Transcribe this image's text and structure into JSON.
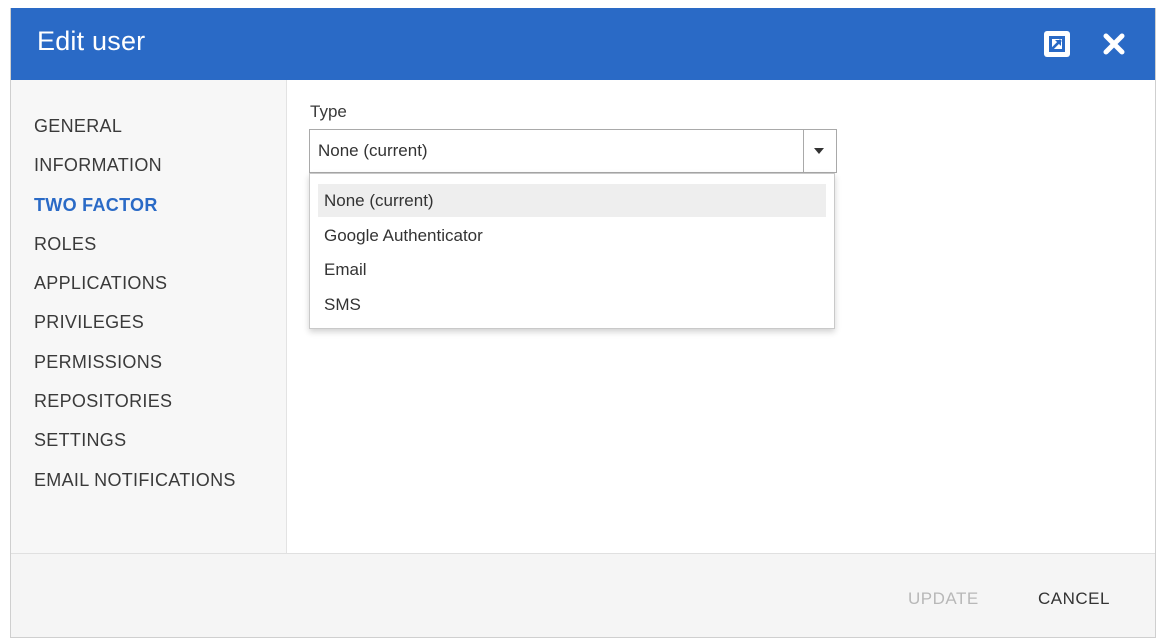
{
  "dialog": {
    "title": "Edit user"
  },
  "sidebar": {
    "items": [
      {
        "label": "GENERAL"
      },
      {
        "label": "INFORMATION"
      },
      {
        "label": "TWO FACTOR"
      },
      {
        "label": "ROLES"
      },
      {
        "label": "APPLICATIONS"
      },
      {
        "label": "PRIVILEGES"
      },
      {
        "label": "PERMISSIONS"
      },
      {
        "label": "REPOSITORIES"
      },
      {
        "label": "SETTINGS"
      },
      {
        "label": "EMAIL NOTIFICATIONS"
      }
    ],
    "active_item": "TWO FACTOR"
  },
  "form": {
    "type_label": "Type",
    "type_value": "None (current)",
    "options": [
      {
        "label": "None (current)"
      },
      {
        "label": "Google Authenticator"
      },
      {
        "label": "Email"
      },
      {
        "label": "SMS"
      }
    ]
  },
  "footer": {
    "update_label": "UPDATE",
    "cancel_label": "CANCEL"
  },
  "colors": {
    "header_bg": "#2a6ac6",
    "active_nav": "#2a6ac6",
    "disabled_text": "#b8b8b8"
  },
  "icons": {
    "maximize": "maximize-icon",
    "close": "close-icon",
    "dropdown_arrow": "caret-down-icon"
  }
}
